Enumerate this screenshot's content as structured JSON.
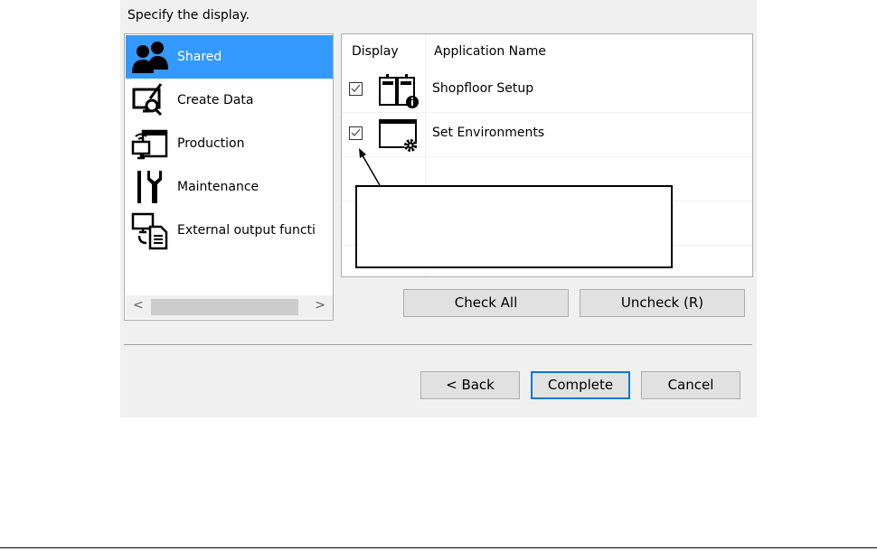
{
  "prompt": "Specify the display.",
  "categories": [
    {
      "label": "Shared",
      "icon": "users-icon",
      "selected": true
    },
    {
      "label": "Create Data",
      "icon": "monitor-search-icon"
    },
    {
      "label": "Production",
      "icon": "production-icon"
    },
    {
      "label": "Maintenance",
      "icon": "tools-icon"
    },
    {
      "label": "External output functi",
      "icon": "external-output-icon"
    }
  ],
  "table": {
    "headers": {
      "display": "Display",
      "name": "Application Name"
    },
    "rows": [
      {
        "checked": true,
        "name": "Shopfloor Setup",
        "icon": "shopfloor-info-icon"
      },
      {
        "checked": true,
        "name": "Set Environments",
        "icon": "window-gear-icon"
      }
    ]
  },
  "buttons": {
    "check_all": "Check All",
    "uncheck": "Uncheck (R)",
    "back": "< Back",
    "complete": "Complete",
    "cancel": "Cancel"
  },
  "scroll": {
    "left": "<",
    "right": ">"
  },
  "colors": {
    "selection": "#3399ff",
    "focus_border": "#0078d7"
  }
}
